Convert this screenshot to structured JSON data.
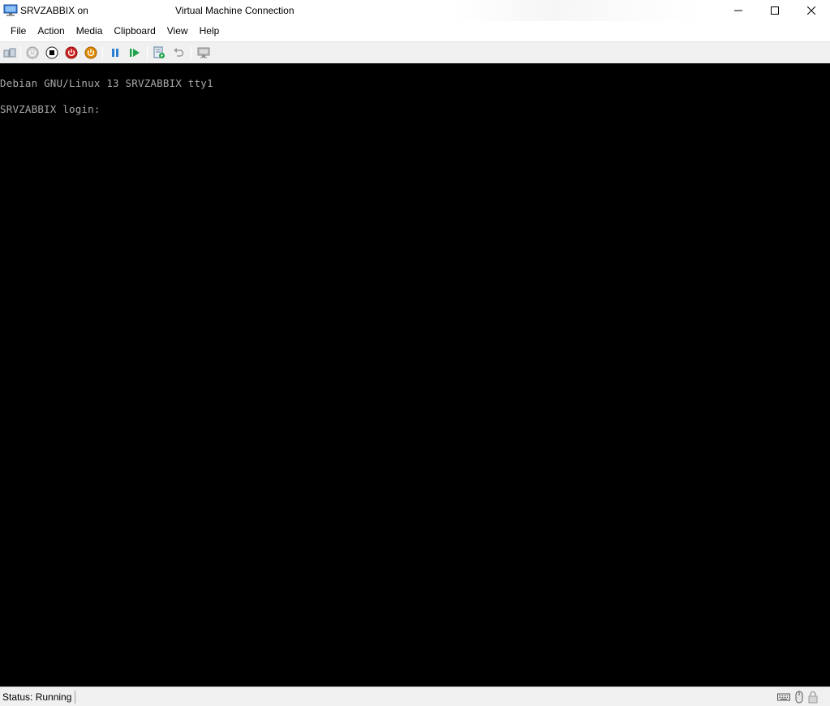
{
  "window": {
    "title_vm": "SRVZABBIX on",
    "title_app": "Virtual Machine Connection",
    "icon": "vm-monitor-icon"
  },
  "menu": [
    "File",
    "Action",
    "Media",
    "Clipboard",
    "View",
    "Help"
  ],
  "toolbar": {
    "icons": [
      "ctrl-alt-del-icon",
      "start-icon",
      "turn-off-icon",
      "shutdown-icon",
      "save-icon",
      "pause-icon",
      "reset-icon",
      "checkpoint-icon",
      "revert-icon",
      "enhanced-session-icon"
    ]
  },
  "console": {
    "line1": "Debian GNU/Linux 13 SRVZABBIX tty1",
    "line2": "SRVZABBIX login: "
  },
  "status": {
    "text": "Status: Running",
    "icons": [
      "keyboard-icon",
      "mouse-icon",
      "lock-icon"
    ]
  },
  "colors": {
    "console_bg": "#000000",
    "console_fg": "#aaaaaa",
    "stop_red": "#cc1f1f",
    "save_orange": "#e08a00",
    "pause_blue": "#2a7fd4",
    "reset_green": "#1fa34a"
  }
}
